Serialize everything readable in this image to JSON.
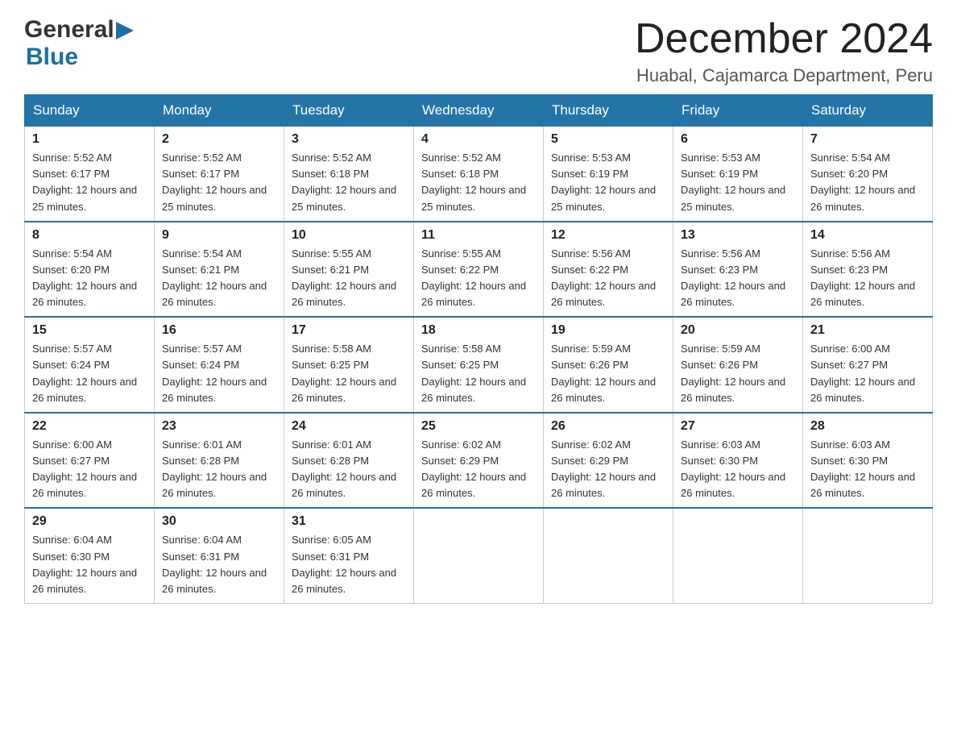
{
  "header": {
    "logo_general": "General",
    "logo_blue": "Blue",
    "month_title": "December 2024",
    "location": "Huabal, Cajamarca Department, Peru"
  },
  "weekdays": [
    "Sunday",
    "Monday",
    "Tuesday",
    "Wednesday",
    "Thursday",
    "Friday",
    "Saturday"
  ],
  "weeks": [
    [
      {
        "day": "1",
        "sunrise": "Sunrise: 5:52 AM",
        "sunset": "Sunset: 6:17 PM",
        "daylight": "Daylight: 12 hours and 25 minutes."
      },
      {
        "day": "2",
        "sunrise": "Sunrise: 5:52 AM",
        "sunset": "Sunset: 6:17 PM",
        "daylight": "Daylight: 12 hours and 25 minutes."
      },
      {
        "day": "3",
        "sunrise": "Sunrise: 5:52 AM",
        "sunset": "Sunset: 6:18 PM",
        "daylight": "Daylight: 12 hours and 25 minutes."
      },
      {
        "day": "4",
        "sunrise": "Sunrise: 5:52 AM",
        "sunset": "Sunset: 6:18 PM",
        "daylight": "Daylight: 12 hours and 25 minutes."
      },
      {
        "day": "5",
        "sunrise": "Sunrise: 5:53 AM",
        "sunset": "Sunset: 6:19 PM",
        "daylight": "Daylight: 12 hours and 25 minutes."
      },
      {
        "day": "6",
        "sunrise": "Sunrise: 5:53 AM",
        "sunset": "Sunset: 6:19 PM",
        "daylight": "Daylight: 12 hours and 25 minutes."
      },
      {
        "day": "7",
        "sunrise": "Sunrise: 5:54 AM",
        "sunset": "Sunset: 6:20 PM",
        "daylight": "Daylight: 12 hours and 26 minutes."
      }
    ],
    [
      {
        "day": "8",
        "sunrise": "Sunrise: 5:54 AM",
        "sunset": "Sunset: 6:20 PM",
        "daylight": "Daylight: 12 hours and 26 minutes."
      },
      {
        "day": "9",
        "sunrise": "Sunrise: 5:54 AM",
        "sunset": "Sunset: 6:21 PM",
        "daylight": "Daylight: 12 hours and 26 minutes."
      },
      {
        "day": "10",
        "sunrise": "Sunrise: 5:55 AM",
        "sunset": "Sunset: 6:21 PM",
        "daylight": "Daylight: 12 hours and 26 minutes."
      },
      {
        "day": "11",
        "sunrise": "Sunrise: 5:55 AM",
        "sunset": "Sunset: 6:22 PM",
        "daylight": "Daylight: 12 hours and 26 minutes."
      },
      {
        "day": "12",
        "sunrise": "Sunrise: 5:56 AM",
        "sunset": "Sunset: 6:22 PM",
        "daylight": "Daylight: 12 hours and 26 minutes."
      },
      {
        "day": "13",
        "sunrise": "Sunrise: 5:56 AM",
        "sunset": "Sunset: 6:23 PM",
        "daylight": "Daylight: 12 hours and 26 minutes."
      },
      {
        "day": "14",
        "sunrise": "Sunrise: 5:56 AM",
        "sunset": "Sunset: 6:23 PM",
        "daylight": "Daylight: 12 hours and 26 minutes."
      }
    ],
    [
      {
        "day": "15",
        "sunrise": "Sunrise: 5:57 AM",
        "sunset": "Sunset: 6:24 PM",
        "daylight": "Daylight: 12 hours and 26 minutes."
      },
      {
        "day": "16",
        "sunrise": "Sunrise: 5:57 AM",
        "sunset": "Sunset: 6:24 PM",
        "daylight": "Daylight: 12 hours and 26 minutes."
      },
      {
        "day": "17",
        "sunrise": "Sunrise: 5:58 AM",
        "sunset": "Sunset: 6:25 PM",
        "daylight": "Daylight: 12 hours and 26 minutes."
      },
      {
        "day": "18",
        "sunrise": "Sunrise: 5:58 AM",
        "sunset": "Sunset: 6:25 PM",
        "daylight": "Daylight: 12 hours and 26 minutes."
      },
      {
        "day": "19",
        "sunrise": "Sunrise: 5:59 AM",
        "sunset": "Sunset: 6:26 PM",
        "daylight": "Daylight: 12 hours and 26 minutes."
      },
      {
        "day": "20",
        "sunrise": "Sunrise: 5:59 AM",
        "sunset": "Sunset: 6:26 PM",
        "daylight": "Daylight: 12 hours and 26 minutes."
      },
      {
        "day": "21",
        "sunrise": "Sunrise: 6:00 AM",
        "sunset": "Sunset: 6:27 PM",
        "daylight": "Daylight: 12 hours and 26 minutes."
      }
    ],
    [
      {
        "day": "22",
        "sunrise": "Sunrise: 6:00 AM",
        "sunset": "Sunset: 6:27 PM",
        "daylight": "Daylight: 12 hours and 26 minutes."
      },
      {
        "day": "23",
        "sunrise": "Sunrise: 6:01 AM",
        "sunset": "Sunset: 6:28 PM",
        "daylight": "Daylight: 12 hours and 26 minutes."
      },
      {
        "day": "24",
        "sunrise": "Sunrise: 6:01 AM",
        "sunset": "Sunset: 6:28 PM",
        "daylight": "Daylight: 12 hours and 26 minutes."
      },
      {
        "day": "25",
        "sunrise": "Sunrise: 6:02 AM",
        "sunset": "Sunset: 6:29 PM",
        "daylight": "Daylight: 12 hours and 26 minutes."
      },
      {
        "day": "26",
        "sunrise": "Sunrise: 6:02 AM",
        "sunset": "Sunset: 6:29 PM",
        "daylight": "Daylight: 12 hours and 26 minutes."
      },
      {
        "day": "27",
        "sunrise": "Sunrise: 6:03 AM",
        "sunset": "Sunset: 6:30 PM",
        "daylight": "Daylight: 12 hours and 26 minutes."
      },
      {
        "day": "28",
        "sunrise": "Sunrise: 6:03 AM",
        "sunset": "Sunset: 6:30 PM",
        "daylight": "Daylight: 12 hours and 26 minutes."
      }
    ],
    [
      {
        "day": "29",
        "sunrise": "Sunrise: 6:04 AM",
        "sunset": "Sunset: 6:30 PM",
        "daylight": "Daylight: 12 hours and 26 minutes."
      },
      {
        "day": "30",
        "sunrise": "Sunrise: 6:04 AM",
        "sunset": "Sunset: 6:31 PM",
        "daylight": "Daylight: 12 hours and 26 minutes."
      },
      {
        "day": "31",
        "sunrise": "Sunrise: 6:05 AM",
        "sunset": "Sunset: 6:31 PM",
        "daylight": "Daylight: 12 hours and 26 minutes."
      },
      null,
      null,
      null,
      null
    ]
  ]
}
